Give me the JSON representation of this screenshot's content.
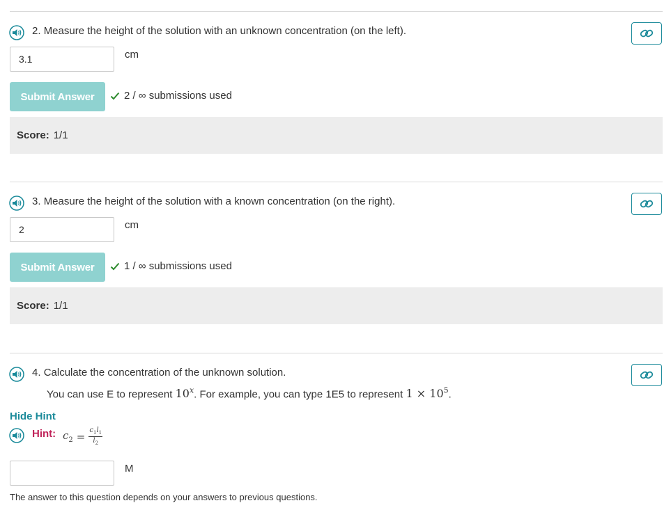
{
  "questions": [
    {
      "number": "2.",
      "prompt": "Measure the height of the solution with an unknown concentration (on the left).",
      "answer_value": "3.1",
      "unit": "cm",
      "submit_label": "Submit Answer",
      "submissions_text": "2 / ∞ submissions used",
      "score_label": "Score:",
      "score_value": "1/1"
    },
    {
      "number": "3.",
      "prompt": "Measure the height of the solution with a known concentration (on the right).",
      "answer_value": "2",
      "unit": "cm",
      "submit_label": "Submit Answer",
      "submissions_text": "1 / ∞ submissions used",
      "score_label": "Score:",
      "score_value": "1/1"
    },
    {
      "number": "4.",
      "prompt": "Calculate the concentration of the unknown solution.",
      "instruction_before": "You can use E to represent",
      "instruction_base": "10",
      "instruction_exp": "x",
      "instruction_middle": ". For example, you can type 1E5 to represent",
      "example_coef": "1",
      "example_times": "×",
      "example_base": "10",
      "example_exp": "5",
      "instruction_end": ".",
      "hide_hint_label": "Hide Hint",
      "hint_label": "Hint:",
      "hint_formula": {
        "lhs": "c",
        "lhs_sub": "2",
        "equals": "=",
        "num_c": "c",
        "num_c_sub": "1",
        "num_l": "l",
        "num_l_sub": "1",
        "den_l": "l",
        "den_l_sub": "2"
      },
      "answer_value": "",
      "unit": "M",
      "footnote": "The answer to this question depends on your answers to previous questions."
    }
  ],
  "icons": {
    "speaker": "speaker-icon",
    "link": "link-icon",
    "check": "check-icon"
  },
  "colors": {
    "accent": "#1a8a9a",
    "submit_bg": "#8fd2d0",
    "check": "#2e8b2e",
    "hint": "#c0245a",
    "score_bg": "#ededed"
  }
}
